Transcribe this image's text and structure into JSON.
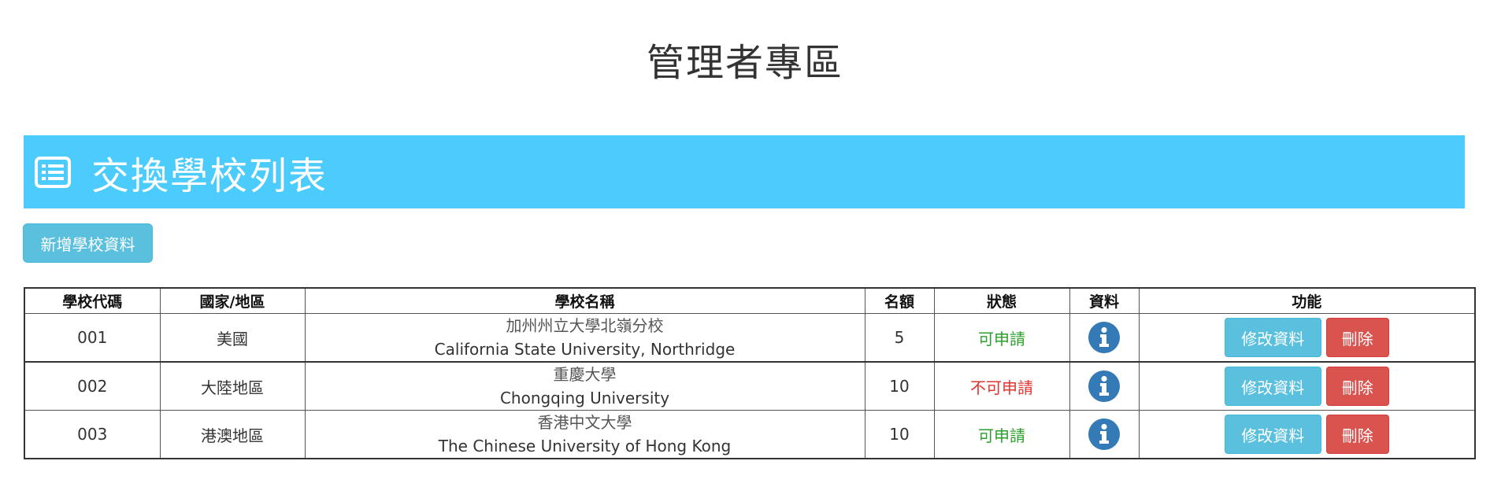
{
  "page": {
    "title": "管理者專區"
  },
  "banner": {
    "icon": "list-alt-icon",
    "title": "交換學校列表",
    "background_color": "#4ccbfd"
  },
  "toolbar": {
    "add_label": "新增學校資料"
  },
  "table": {
    "headers": [
      "學校代碼",
      "國家/地區",
      "學校名稱",
      "名額",
      "狀態",
      "資料",
      "功能"
    ],
    "rows": [
      {
        "code": "001",
        "region": "美國",
        "name_zh": "加州州立大學北嶺分校",
        "name_en": "California State University, Northridge",
        "quota": "5",
        "status": "可申請",
        "status_color": "#2ca02c",
        "info_icon": "info-circle-icon",
        "edit_label": "修改資料",
        "delete_label": "刪除"
      },
      {
        "code": "002",
        "region": "大陸地區",
        "name_zh": "重慶大學",
        "name_en": "Chongqing University",
        "quota": "10",
        "status": "不可申請",
        "status_color": "#e0342f",
        "info_icon": "info-circle-icon",
        "edit_label": "修改資料",
        "delete_label": "刪除"
      },
      {
        "code": "003",
        "region": "港澳地區",
        "name_zh": "香港中文大學",
        "name_en": "The Chinese University of Hong Kong",
        "quota": "10",
        "status": "可申請",
        "status_color": "#2ca02c",
        "info_icon": "info-circle-icon",
        "edit_label": "修改資料",
        "delete_label": "刪除"
      }
    ]
  },
  "colors": {
    "edit_button": "#5bc0de",
    "delete_button": "#d9534f",
    "info_icon": "#337ab7"
  }
}
